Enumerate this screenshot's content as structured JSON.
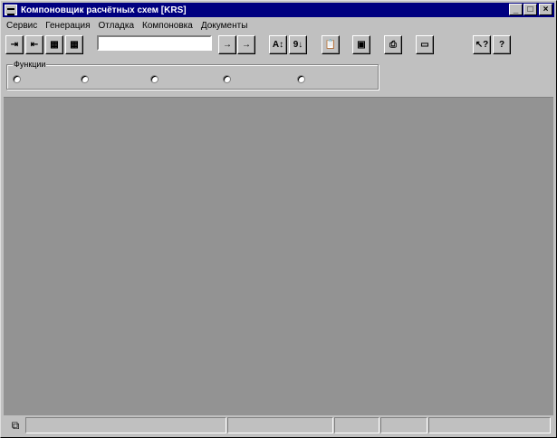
{
  "window": {
    "title": "Компоновщик расчётных схем [KRS]",
    "caption_buttons": {
      "minimize": "_",
      "maximize": "□",
      "close": "×"
    }
  },
  "menu": {
    "items": [
      "Сервис",
      "Генерация",
      "Отладка",
      "Компоновка",
      "Документы"
    ]
  },
  "toolbar": {
    "buttons": [
      {
        "name": "insert-row-icon",
        "glyph": "⇥"
      },
      {
        "name": "delete-row-icon",
        "glyph": "⇤"
      },
      {
        "name": "table-add-icon",
        "glyph": "▦"
      },
      {
        "name": "table-calc-icon",
        "glyph": "▦"
      },
      {
        "name": "move-down-icon",
        "glyph": "→"
      },
      {
        "name": "move-up-icon",
        "glyph": "→"
      },
      {
        "name": "sort-az-icon",
        "glyph": "A↕"
      },
      {
        "name": "sort-91-icon",
        "glyph": "9↓"
      },
      {
        "name": "paste-icon",
        "glyph": "📋"
      },
      {
        "name": "image-icon",
        "glyph": "▣"
      },
      {
        "name": "print-icon",
        "glyph": "⎙"
      },
      {
        "name": "open-folder-icon",
        "glyph": "▭"
      },
      {
        "name": "context-help-icon",
        "glyph": "↖?"
      },
      {
        "name": "help-icon",
        "glyph": "?"
      }
    ],
    "search_value": ""
  },
  "functions_group": {
    "legend": "Функции",
    "options": [
      "",
      "",
      "",
      "",
      ""
    ]
  },
  "statusbar": {
    "icon": "book-icon",
    "panes": [
      "",
      "",
      "",
      "",
      ""
    ]
  }
}
